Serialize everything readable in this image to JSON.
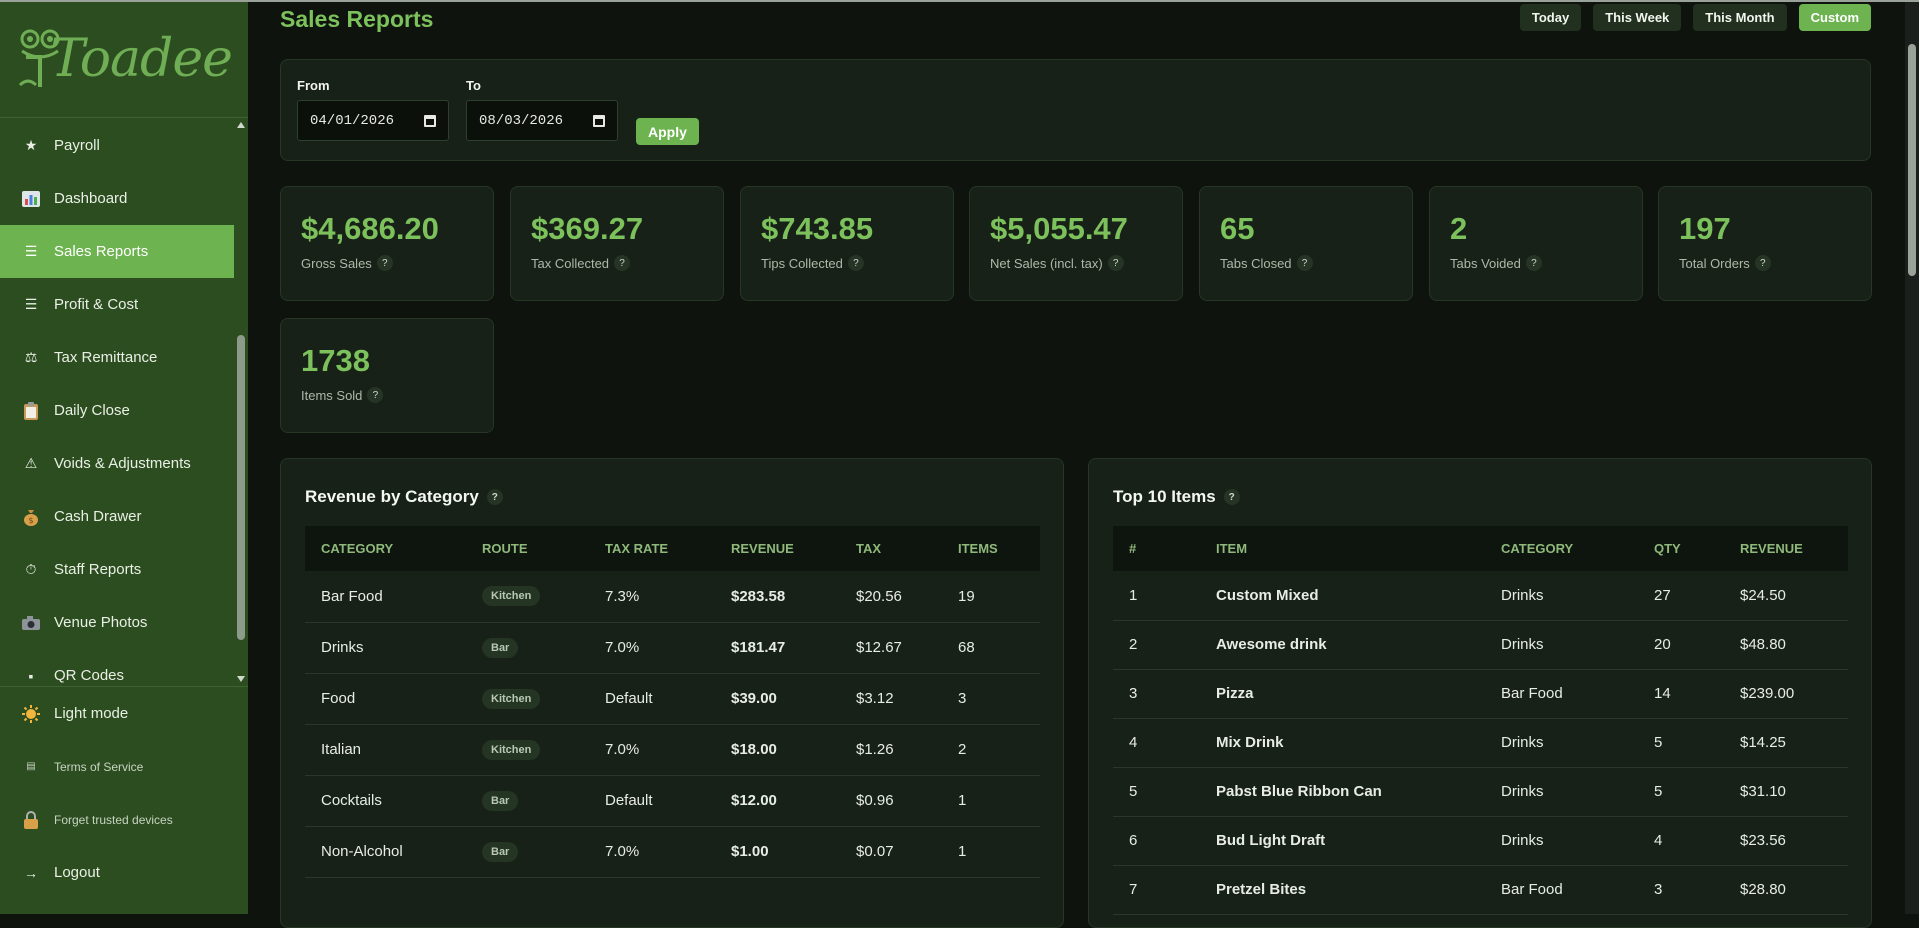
{
  "brand": {
    "name": "Toadee"
  },
  "sidebar": {
    "items": [
      {
        "label": "Payroll",
        "icon": "star-icon"
      },
      {
        "label": "Dashboard",
        "icon": "bar-chart-icon"
      },
      {
        "label": "Sales Reports",
        "icon": "list-icon",
        "active": true
      },
      {
        "label": "Profit & Cost",
        "icon": "lines-icon"
      },
      {
        "label": "Tax Remittance",
        "icon": "scales-icon"
      },
      {
        "label": "Daily Close",
        "icon": "clipboard-icon"
      },
      {
        "label": "Voids & Adjustments",
        "icon": "warning-icon"
      },
      {
        "label": "Cash Drawer",
        "icon": "money-bag-icon"
      },
      {
        "label": "Staff Reports",
        "icon": "stopwatch-icon"
      },
      {
        "label": "Venue Photos",
        "icon": "camera-icon"
      },
      {
        "label": "QR Codes",
        "icon": "qr-icon"
      }
    ],
    "bottom": {
      "light_mode": "Light mode",
      "terms": "Terms of Service",
      "forget": "Forget trusted devices",
      "logout": "Logout"
    }
  },
  "header": {
    "title": "Sales Reports",
    "ranges": [
      "Today",
      "This Week",
      "This Month",
      "Custom"
    ],
    "active_range": "Custom"
  },
  "filter": {
    "from_label": "From",
    "from_value": "04/01/2026",
    "to_label": "To",
    "to_value": "08/03/2026",
    "apply": "Apply"
  },
  "stats": [
    {
      "value": "$4,686.20",
      "label": "Gross Sales"
    },
    {
      "value": "$369.27",
      "label": "Tax Collected"
    },
    {
      "value": "$743.85",
      "label": "Tips Collected"
    },
    {
      "value": "$5,055.47",
      "label": "Net Sales (incl. tax)"
    },
    {
      "value": "65",
      "label": "Tabs Closed"
    },
    {
      "value": "2",
      "label": "Tabs Voided"
    },
    {
      "value": "197",
      "label": "Total Orders"
    },
    {
      "value": "1738",
      "label": "Items Sold"
    }
  ],
  "revenue_by_category": {
    "title": "Revenue by Category",
    "columns": [
      "CATEGORY",
      "ROUTE",
      "TAX RATE",
      "REVENUE",
      "TAX",
      "ITEMS"
    ],
    "rows": [
      [
        "Bar Food",
        "Kitchen",
        "7.3%",
        "$283.58",
        "$20.56",
        "19"
      ],
      [
        "Drinks",
        "Bar",
        "7.0%",
        "$181.47",
        "$12.67",
        "68"
      ],
      [
        "Food",
        "Kitchen",
        "Default",
        "$39.00",
        "$3.12",
        "3"
      ],
      [
        "Italian",
        "Kitchen",
        "7.0%",
        "$18.00",
        "$1.26",
        "2"
      ],
      [
        "Cocktails",
        "Bar",
        "Default",
        "$12.00",
        "$0.96",
        "1"
      ],
      [
        "Non-Alcohol",
        "Bar",
        "7.0%",
        "$1.00",
        "$0.07",
        "1"
      ]
    ]
  },
  "top_items": {
    "title": "Top 10 Items",
    "columns": [
      "#",
      "ITEM",
      "CATEGORY",
      "QTY",
      "REVENUE"
    ],
    "rows": [
      [
        "1",
        "Custom Mixed",
        "Drinks",
        "27",
        "$24.50"
      ],
      [
        "2",
        "Awesome drink",
        "Drinks",
        "20",
        "$48.80"
      ],
      [
        "3",
        "Pizza",
        "Bar Food",
        "14",
        "$239.00"
      ],
      [
        "4",
        "Mix Drink",
        "Drinks",
        "5",
        "$14.25"
      ],
      [
        "5",
        "Pabst Blue Ribbon Can",
        "Drinks",
        "5",
        "$31.10"
      ],
      [
        "6",
        "Bud Light Draft",
        "Drinks",
        "4",
        "$23.56"
      ],
      [
        "7",
        "Pretzel Bites",
        "Bar Food",
        "3",
        "$28.80"
      ]
    ]
  },
  "help_glyph": "?",
  "colors": {
    "accent": "#6db34f",
    "sidebar": "#2c4d1f",
    "bg": "#0e130e",
    "card": "#172117"
  }
}
